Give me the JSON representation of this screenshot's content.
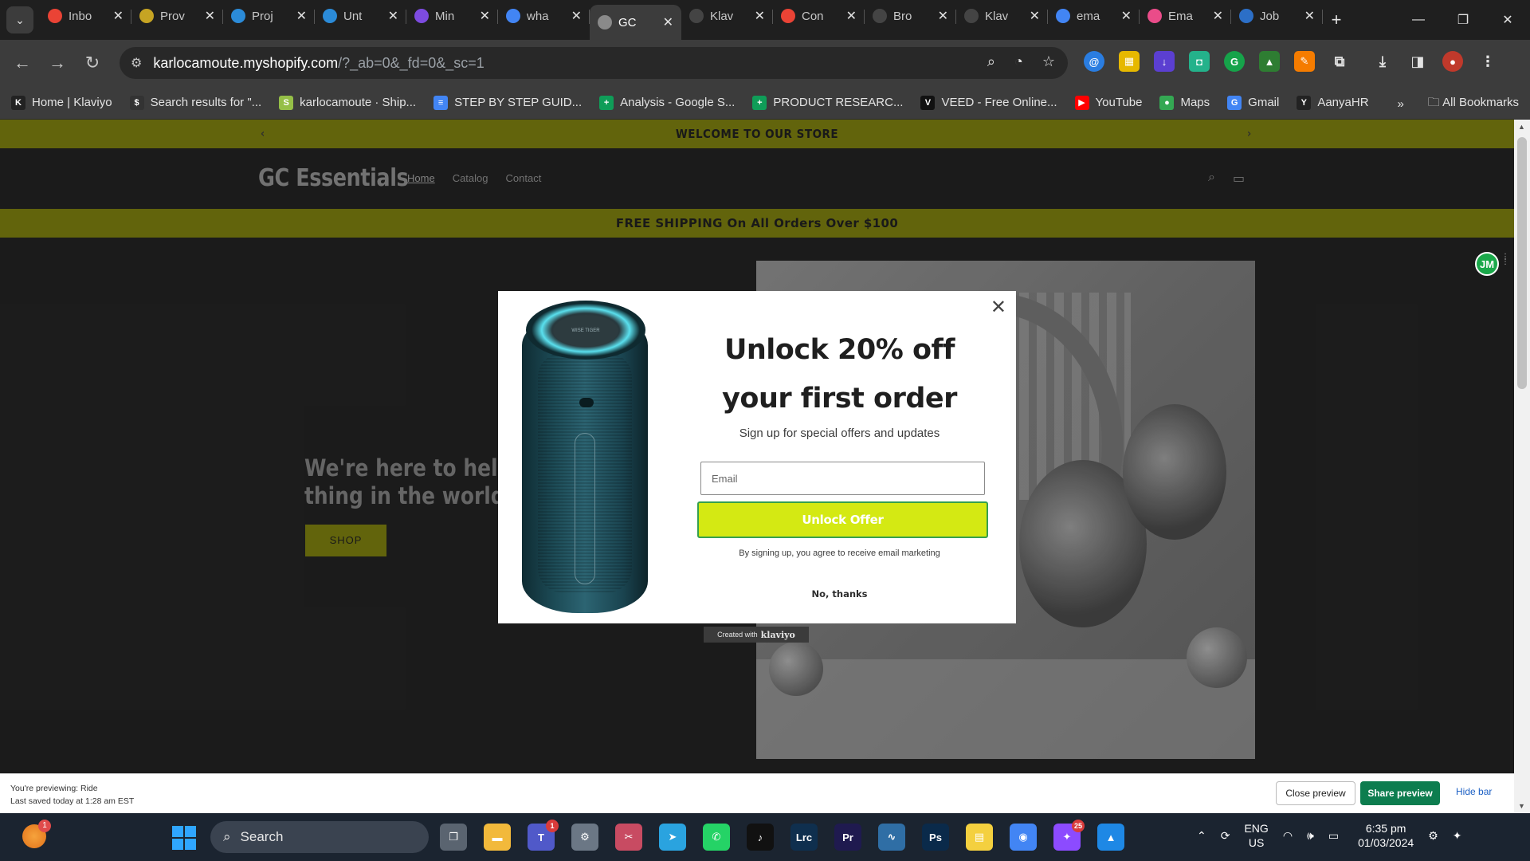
{
  "browser": {
    "tabs": [
      {
        "title": "Inbo",
        "icon": "gmail-icon",
        "color": "#ea4335"
      },
      {
        "title": "Prov",
        "icon": "provider-icon",
        "color": "#c6a423"
      },
      {
        "title": "Proj",
        "icon": "canva-icon",
        "color": "#2b8bd8"
      },
      {
        "title": "Unt",
        "icon": "canva-icon",
        "color": "#2b8bd8"
      },
      {
        "title": "Min",
        "icon": "heart-icon",
        "color": "#7d4be0"
      },
      {
        "title": "wha",
        "icon": "google-icon",
        "color": "#4285f4"
      },
      {
        "title": "GC",
        "icon": "globe-icon",
        "color": "#8a8a8a",
        "active": true
      },
      {
        "title": "Klav",
        "icon": "klaviyo-icon",
        "color": "#444444"
      },
      {
        "title": "Con",
        "icon": "gmail-icon",
        "color": "#ea4335"
      },
      {
        "title": "Bro",
        "icon": "klaviyo-icon",
        "color": "#444444"
      },
      {
        "title": "Klav",
        "icon": "klaviyo-icon",
        "color": "#444444"
      },
      {
        "title": "ema",
        "icon": "google-icon",
        "color": "#4285f4"
      },
      {
        "title": "Ema",
        "icon": "dribbble-icon",
        "color": "#ea4c89"
      },
      {
        "title": "Job",
        "icon": "jobs-icon",
        "color": "#2c6fc7"
      }
    ],
    "url_host": "karlocamoute.myshopify.com",
    "url_path": "/?_ab=0&_fd=0&_sc=1",
    "bookmarks": [
      {
        "label": "Home | Klaviyo",
        "color": "#222222",
        "glyph": "K"
      },
      {
        "label": "Search results for \"...",
        "color": "#333333",
        "glyph": "$"
      },
      {
        "label": "karlocamoute · Ship...",
        "color": "#95bf47",
        "glyph": "S"
      },
      {
        "label": "STEP BY STEP GUID...",
        "color": "#4285f4",
        "glyph": "≡"
      },
      {
        "label": "Analysis - Google S...",
        "color": "#0f9d58",
        "glyph": "+"
      },
      {
        "label": "PRODUCT RESEARC...",
        "color": "#0f9d58",
        "glyph": "+"
      },
      {
        "label": "VEED - Free Online...",
        "color": "#111111",
        "glyph": "V"
      },
      {
        "label": "YouTube",
        "color": "#ff0000",
        "glyph": "▶"
      },
      {
        "label": "Maps",
        "color": "#34a853",
        "glyph": "●"
      },
      {
        "label": "Gmail",
        "color": "#4285f4",
        "glyph": "G"
      },
      {
        "label": "AanyaHR",
        "color": "#222222",
        "glyph": "Y"
      }
    ],
    "all_bookmarks": "All Bookmarks"
  },
  "store": {
    "announcement": "WELCOME TO OUR STORE",
    "logo": "GC Essentials",
    "nav": [
      "Home",
      "Catalog",
      "Contact"
    ],
    "shipping": "FREE SHIPPING On All Orders Over $100",
    "hero_line1": "We're here to help yo",
    "hero_line2": "thing in the world of",
    "shop_label": "SHOP",
    "accent": "#6b6d0e"
  },
  "popup": {
    "title_line1": "Unlock 20% off",
    "title_line2": "your first order",
    "subtitle": "Sign up for special offers and updates",
    "email_placeholder": "Email",
    "cta_label": "Unlock Offer",
    "legal": "By signing up, you agree to receive email marketing",
    "decline": "No, thanks",
    "badge_prefix": "Created with",
    "badge_brand": "klaviyo",
    "cta_color": "#d4e913",
    "speaker_brand": "WISE TIGER"
  },
  "side_widget": {
    "label": "JM"
  },
  "preview_bar": {
    "line1": "You're previewing: Ride",
    "line2": "Last saved today at 1:28 am EST",
    "close_label": "Close preview",
    "share_label": "Share preview",
    "hide_label": "Hide bar"
  },
  "taskbar": {
    "search_label": "Search",
    "weather_badge": "1",
    "lang_line1": "ENG",
    "lang_line2": "US",
    "time": "6:35 pm",
    "date": "01/03/2024",
    "apps": [
      {
        "name": "task-view-icon",
        "color": "#5a6470",
        "glyph": "❐"
      },
      {
        "name": "file-explorer-icon",
        "color": "#f2b93b",
        "glyph": "▬"
      },
      {
        "name": "teams-icon",
        "color": "#5059c9",
        "glyph": "T",
        "badge": "1"
      },
      {
        "name": "settings-icon",
        "color": "#6b7785",
        "glyph": "⚙"
      },
      {
        "name": "snipping-tool-icon",
        "color": "#c84b62",
        "glyph": "✂"
      },
      {
        "name": "telegram-icon",
        "color": "#2aa3df",
        "glyph": "➤"
      },
      {
        "name": "whatsapp-icon",
        "color": "#25d366",
        "glyph": "✆"
      },
      {
        "name": "tiktok-icon",
        "color": "#111111",
        "glyph": "♪"
      },
      {
        "name": "lightroom-classic-icon",
        "color": "#0f2f4e",
        "glyph": "Lrc"
      },
      {
        "name": "premiere-icon",
        "color": "#1f1a4f",
        "glyph": "Pr"
      },
      {
        "name": "resource-monitor-icon",
        "color": "#2f6ea5",
        "glyph": "∿"
      },
      {
        "name": "photoshop-icon",
        "color": "#0a2a4a",
        "glyph": "Ps"
      },
      {
        "name": "sticky-notes-icon",
        "color": "#f4d03f",
        "glyph": "▤"
      },
      {
        "name": "chrome-icon",
        "color": "#4285f4",
        "glyph": "◉"
      },
      {
        "name": "messenger-icon",
        "color": "#8c4bff",
        "glyph": "✦",
        "badge": "25"
      },
      {
        "name": "photos-icon",
        "color": "#1e88e5",
        "glyph": "▲"
      }
    ]
  }
}
